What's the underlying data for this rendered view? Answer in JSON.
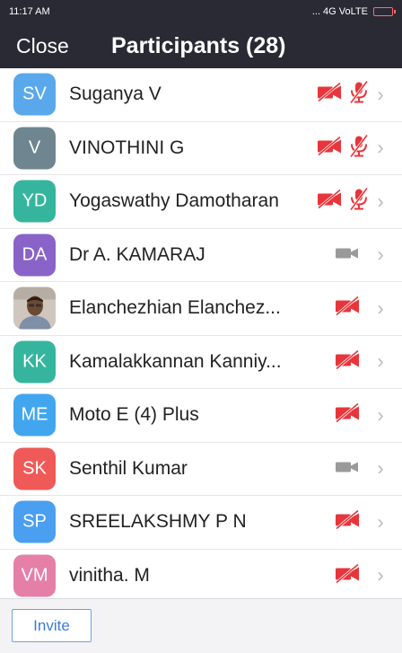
{
  "status_bar": {
    "time": "11:17 AM",
    "right_text": "... 4G VoLTE"
  },
  "header": {
    "close_label": "Close",
    "title": "Participants (28)"
  },
  "participants": [
    {
      "initials": "SV",
      "name": "Suganya V",
      "avatar_color": "#5aa8ec",
      "video": "off",
      "audio": "muted"
    },
    {
      "initials": "V",
      "name": "VINOTHINI G",
      "avatar_color": "#6f8690",
      "video": "off",
      "audio": "muted"
    },
    {
      "initials": "YD",
      "name": "Yogaswathy Damotharan",
      "avatar_color": "#36b59e",
      "video": "off",
      "audio": "muted"
    },
    {
      "initials": "DA",
      "name": "Dr A. KAMARAJ",
      "avatar_color": "#8a63c9",
      "video": "on",
      "audio": "none"
    },
    {
      "initials": "",
      "name": "Elanchezhian Elanchez...",
      "avatar_color": "#d8d3cc",
      "video": "off",
      "audio": "none"
    },
    {
      "initials": "KK",
      "name": "Kamalakkannan Kanniy...",
      "avatar_color": "#36b59e",
      "video": "off",
      "audio": "none"
    },
    {
      "initials": "ME",
      "name": "Moto E (4) Plus",
      "avatar_color": "#42a6ef",
      "video": "off",
      "audio": "none"
    },
    {
      "initials": "SK",
      "name": "Senthil Kumar",
      "avatar_color": "#ef5a58",
      "video": "on",
      "audio": "none"
    },
    {
      "initials": "SP",
      "name": "SREELAKSHMY P N",
      "avatar_color": "#4b9ff0",
      "video": "off",
      "audio": "none"
    },
    {
      "initials": "VM",
      "name": "vinitha. M",
      "avatar_color": "#e57fa8",
      "video": "off",
      "audio": "none"
    }
  ],
  "footer": {
    "invite_label": "Invite"
  },
  "colors": {
    "header_bg": "#2a2a35",
    "muted_red": "#e8353b",
    "video_gray": "#9a9a9a",
    "invite_blue": "#3b7be0"
  }
}
